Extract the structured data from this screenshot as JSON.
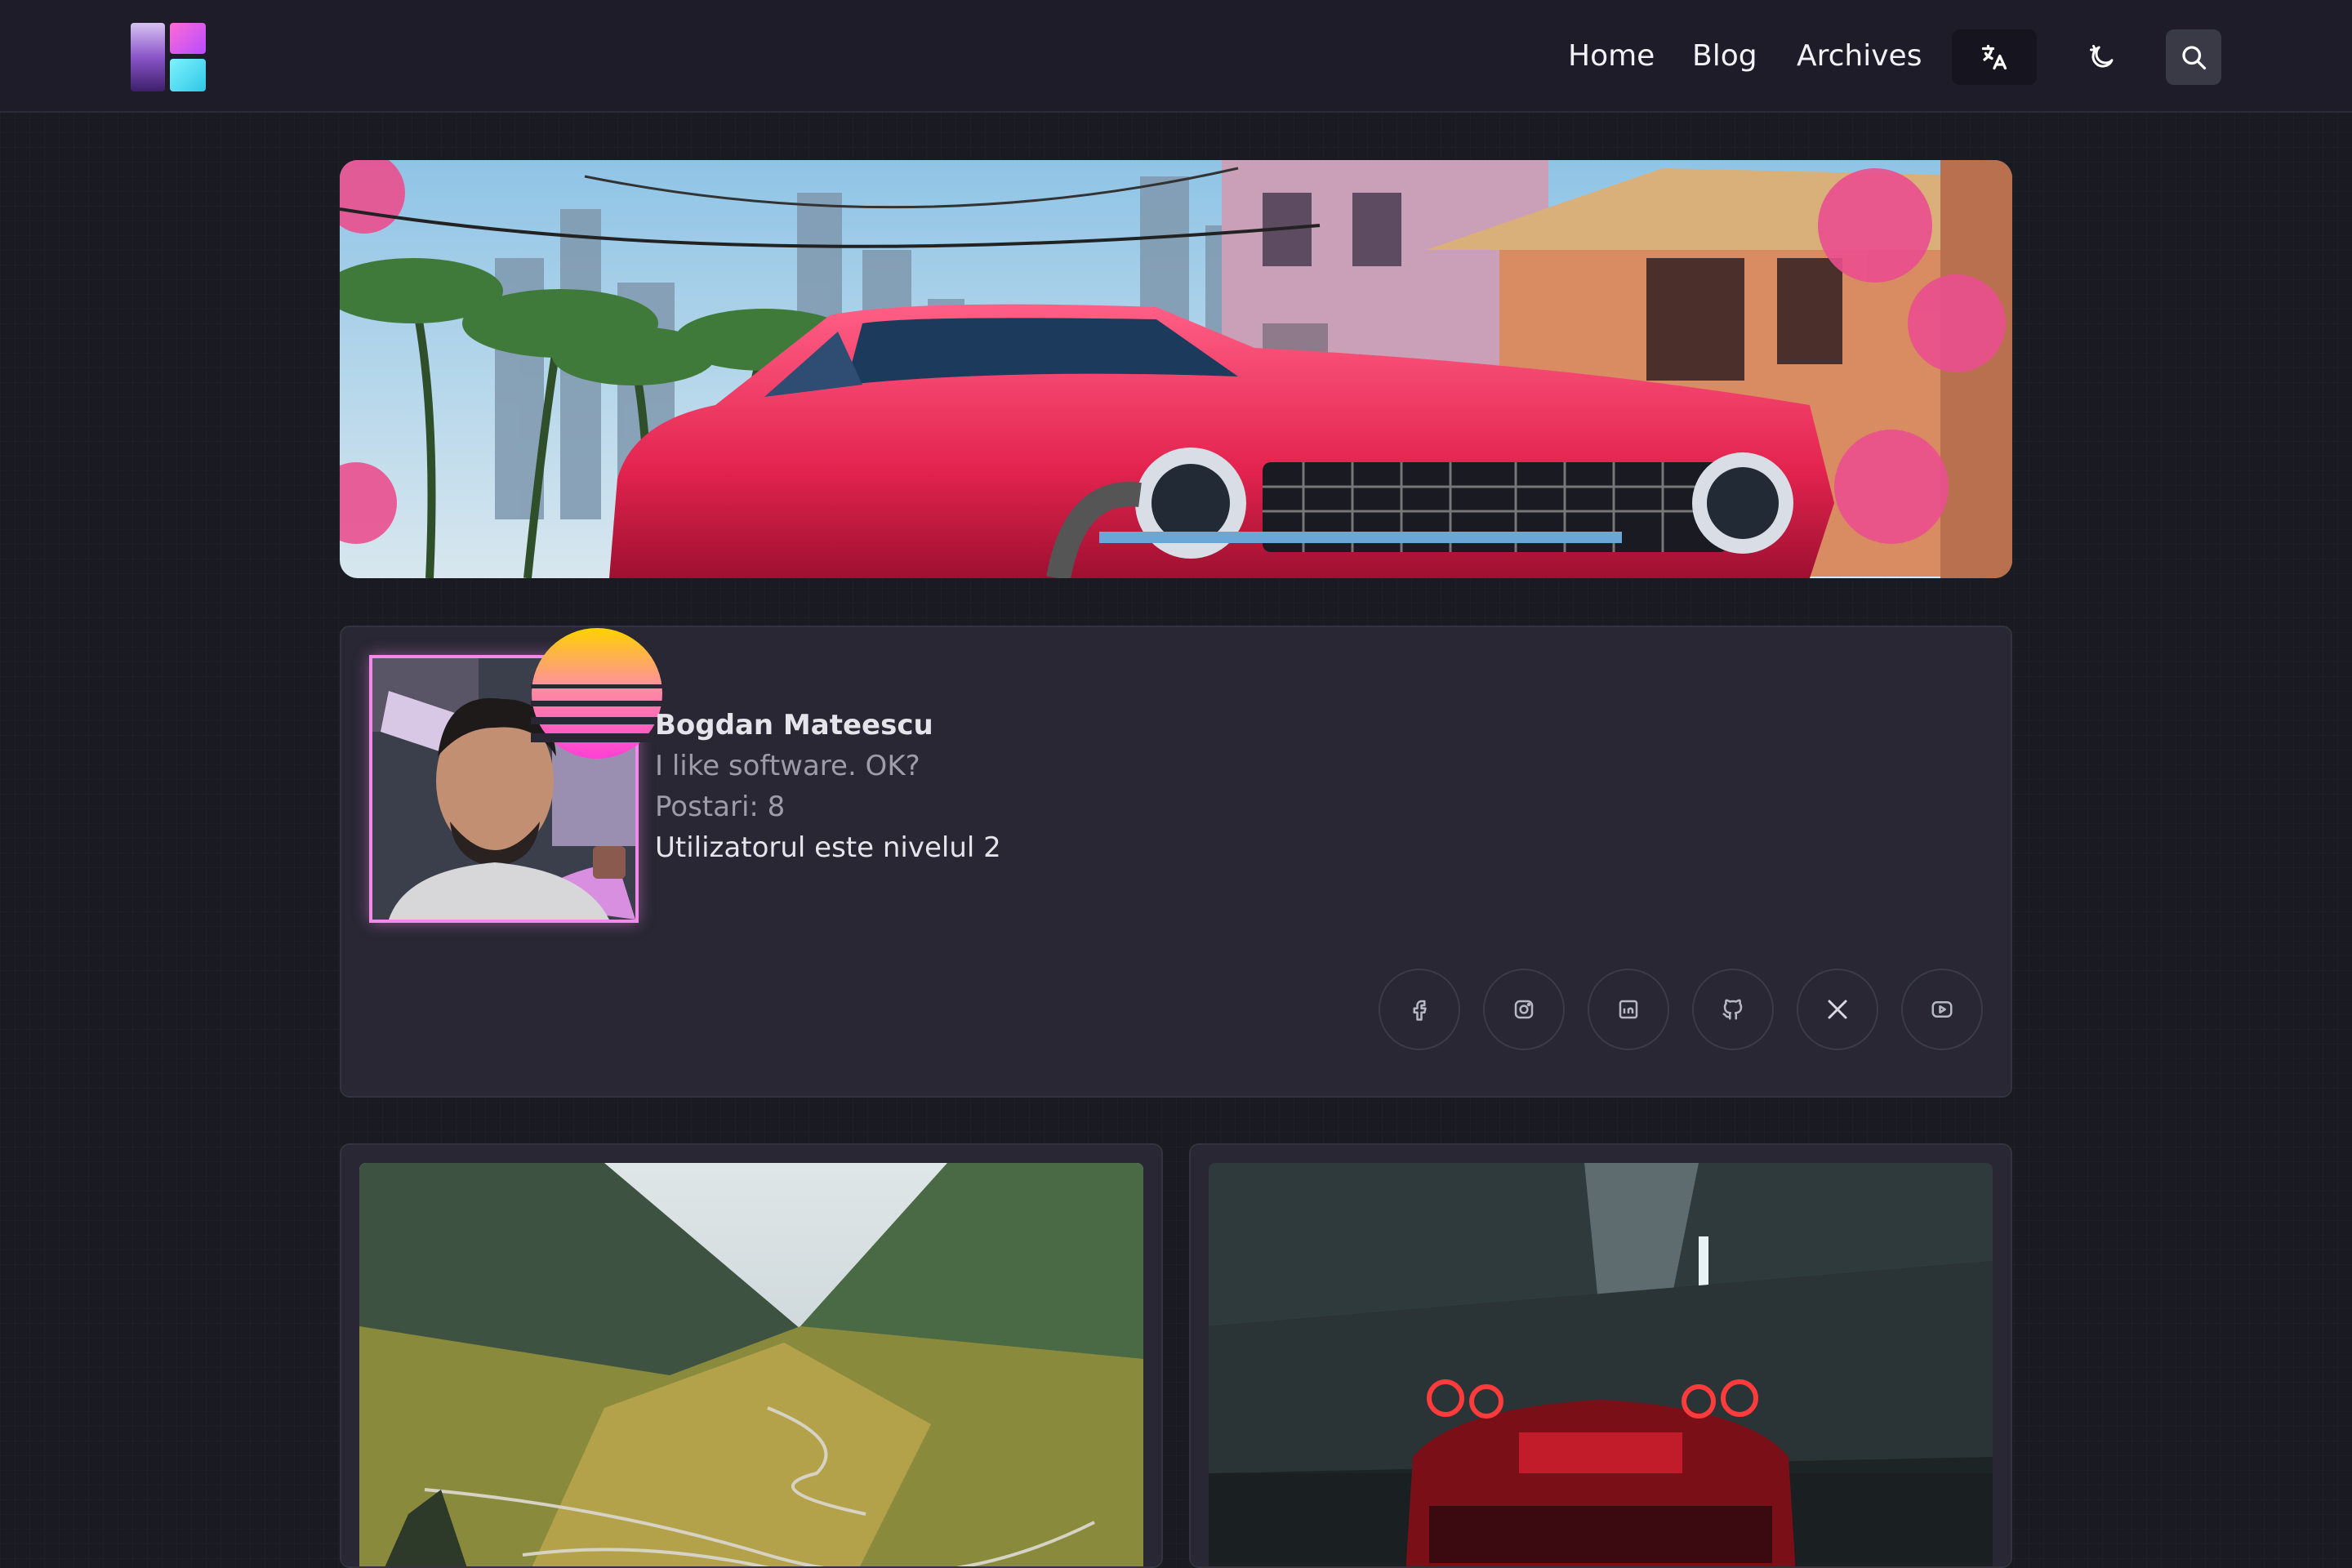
{
  "header": {
    "nav": [
      {
        "label": "Home"
      },
      {
        "label": "Blog"
      },
      {
        "label": "Archives"
      }
    ],
    "icons": {
      "logo": "site-logo",
      "language": "translate-icon",
      "theme": "theme-toggle-icon",
      "search": "search-icon"
    }
  },
  "profile": {
    "name": "Bogdan Mateescu",
    "bio": "I like software. OK?",
    "posts": "Postari: 8",
    "level": "Utilizatorul este nivelul 2",
    "accent_color": "#f18ae8",
    "social": [
      "facebook-icon",
      "instagram-icon",
      "linkedin-icon",
      "github-icon",
      "x-icon",
      "youtube-icon"
    ]
  },
  "colors": {
    "background": "#1a1a23",
    "header": "#1d1c28",
    "card": "#282733",
    "muted_text": "#9d9ca8"
  }
}
